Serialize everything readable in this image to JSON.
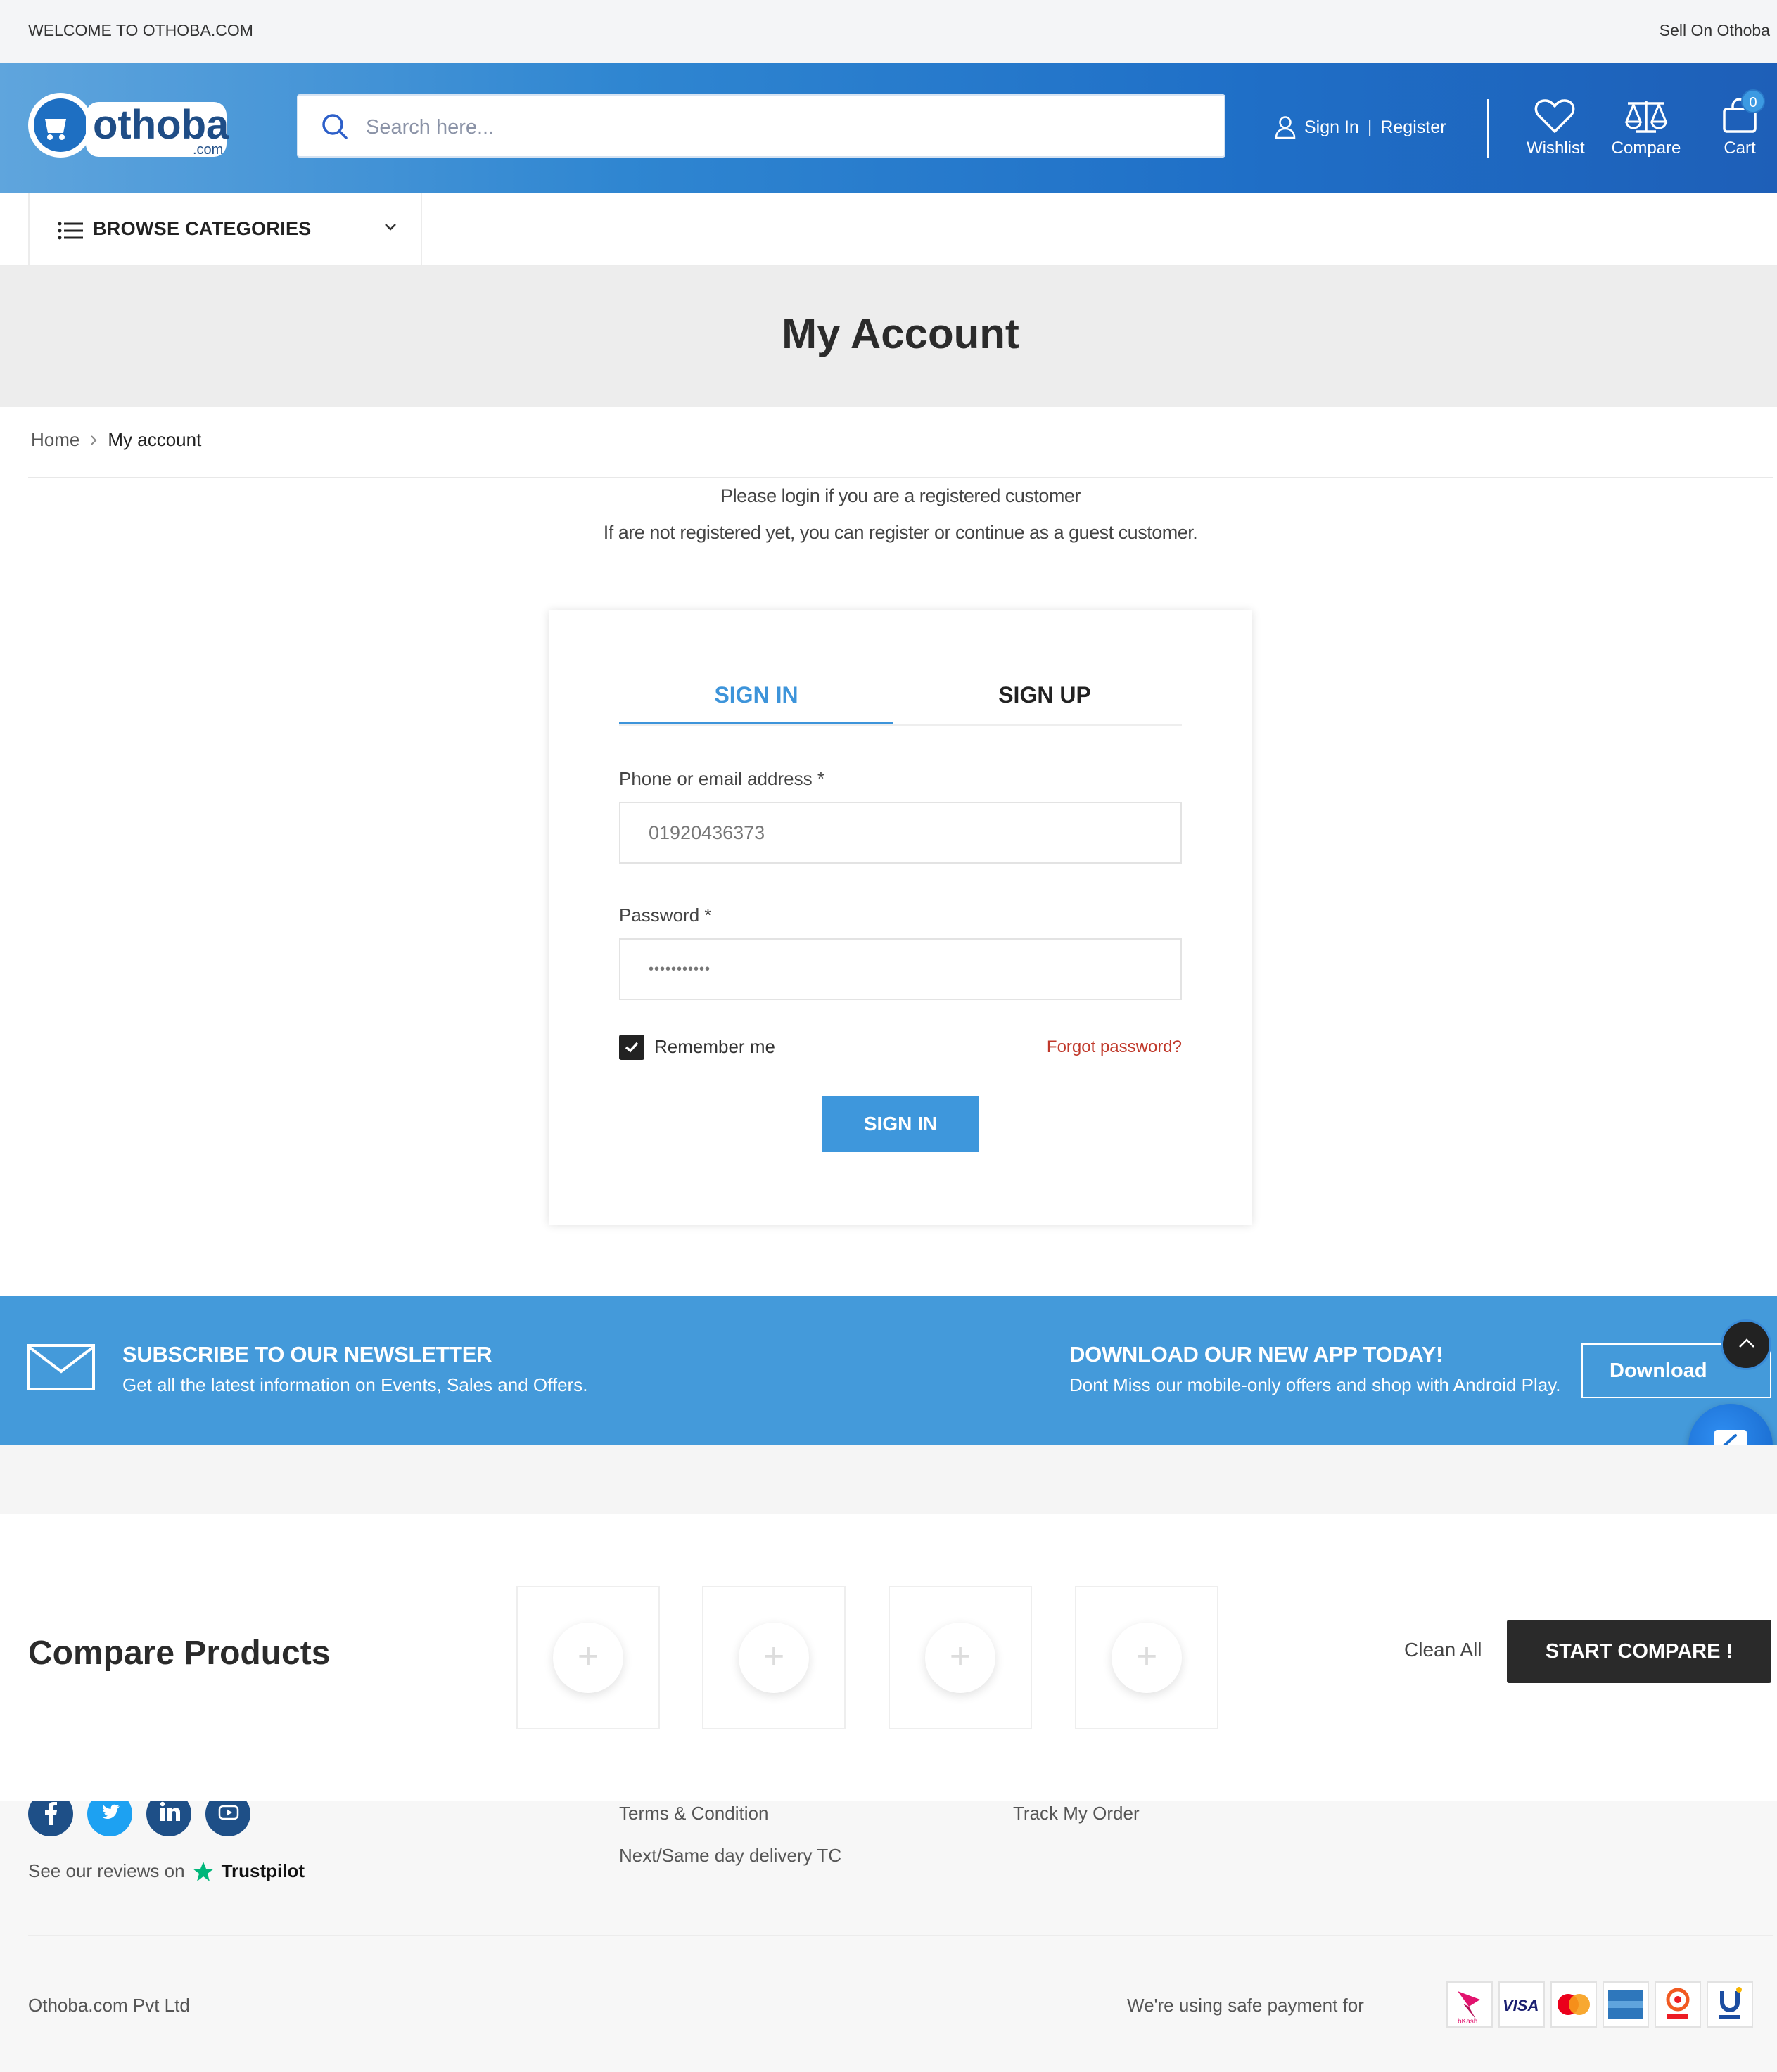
{
  "topbar": {
    "welcome": "WELCOME TO OTHOBA.COM",
    "sell": "Sell On Othoba"
  },
  "header": {
    "logo_text": "othoba",
    "logo_suffix": ".com",
    "search_placeholder": "Search here...",
    "sign_in": "Sign In",
    "separator": "|",
    "register": "Register",
    "wishlist": "Wishlist",
    "compare": "Compare",
    "cart": "Cart",
    "cart_count": "0"
  },
  "categories": {
    "label": "BROWSE CATEGORIES"
  },
  "page": {
    "title": "My Account"
  },
  "breadcrumb": {
    "home": "Home",
    "current": "My account"
  },
  "notes": {
    "line1": "Please login if you are a registered customer",
    "line2": "If are not registered yet, you can register or continue as a guest customer."
  },
  "login": {
    "tab_signin": "SIGN IN",
    "tab_signup": "SIGN UP",
    "phone_label": "Phone or email address *",
    "phone_value": "01920436373",
    "password_label": "Password *",
    "password_value": "•••••••••••",
    "remember": "Remember me",
    "remember_checked": true,
    "forgot": "Forgot password?",
    "submit": "SIGN IN"
  },
  "newsletter": {
    "title": "SUBSCRIBE TO OUR NEWSLETTER",
    "subtitle": "Get all the latest information on Events, Sales and Offers.",
    "app_title": "DOWNLOAD OUR NEW APP TODAY!",
    "app_subtitle": "Dont Miss our mobile-only offers and shop with Android Play.",
    "download": "Download"
  },
  "compare_bar": {
    "title": "Compare Products",
    "slot_symbol": "+",
    "clean": "Clean All",
    "start": "START COMPARE !"
  },
  "footer": {
    "reviews_prefix": "See our reviews on",
    "trustpilot": "Trustpilot",
    "links": [
      "Terms & Condition",
      "Next/Same day delivery TC",
      "Track My Order"
    ],
    "company": "Othoba.com Pvt Ltd",
    "safe_payment": "We're using safe payment for",
    "payment_methods": [
      "bKash",
      "VISA",
      "MasterCard",
      "American Express",
      "Nagad",
      "Upay"
    ]
  },
  "colors": {
    "accent": "#3d94da",
    "header_start": "#5fa5dd",
    "header_end": "#1e5fb8",
    "newsletter_bg": "#449ada",
    "forgot_link": "#c0392b",
    "dark_button": "#2a2a2a"
  }
}
